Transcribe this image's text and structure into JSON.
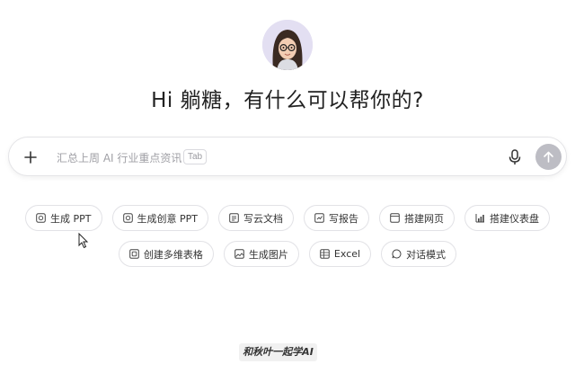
{
  "greeting": "Hi 躺糖，有什么可以帮你的?",
  "search": {
    "placeholder": "汇总上周 AI 行业重点资讯",
    "tab_hint": "Tab"
  },
  "quick_actions_row1": [
    {
      "label": "生成 PPT",
      "icon": "ppt-icon"
    },
    {
      "label": "生成创意 PPT",
      "icon": "creative-ppt-icon"
    },
    {
      "label": "写云文档",
      "icon": "doc-icon"
    },
    {
      "label": "写报告",
      "icon": "report-icon"
    },
    {
      "label": "搭建网页",
      "icon": "webpage-icon"
    },
    {
      "label": "搭建仪表盘",
      "icon": "dashboard-icon"
    }
  ],
  "quick_actions_row2": [
    {
      "label": "创建多维表格",
      "icon": "table-icon"
    },
    {
      "label": "生成图片",
      "icon": "image-icon"
    },
    {
      "label": "Excel",
      "icon": "excel-icon"
    },
    {
      "label": "对话模式",
      "icon": "chat-icon"
    }
  ],
  "watermark": "和秋叶一起学AI",
  "colors": {
    "send_button": "#bdbdc4",
    "chip_border": "#e2e2e6",
    "avatar_bg": "#e3dff2"
  }
}
